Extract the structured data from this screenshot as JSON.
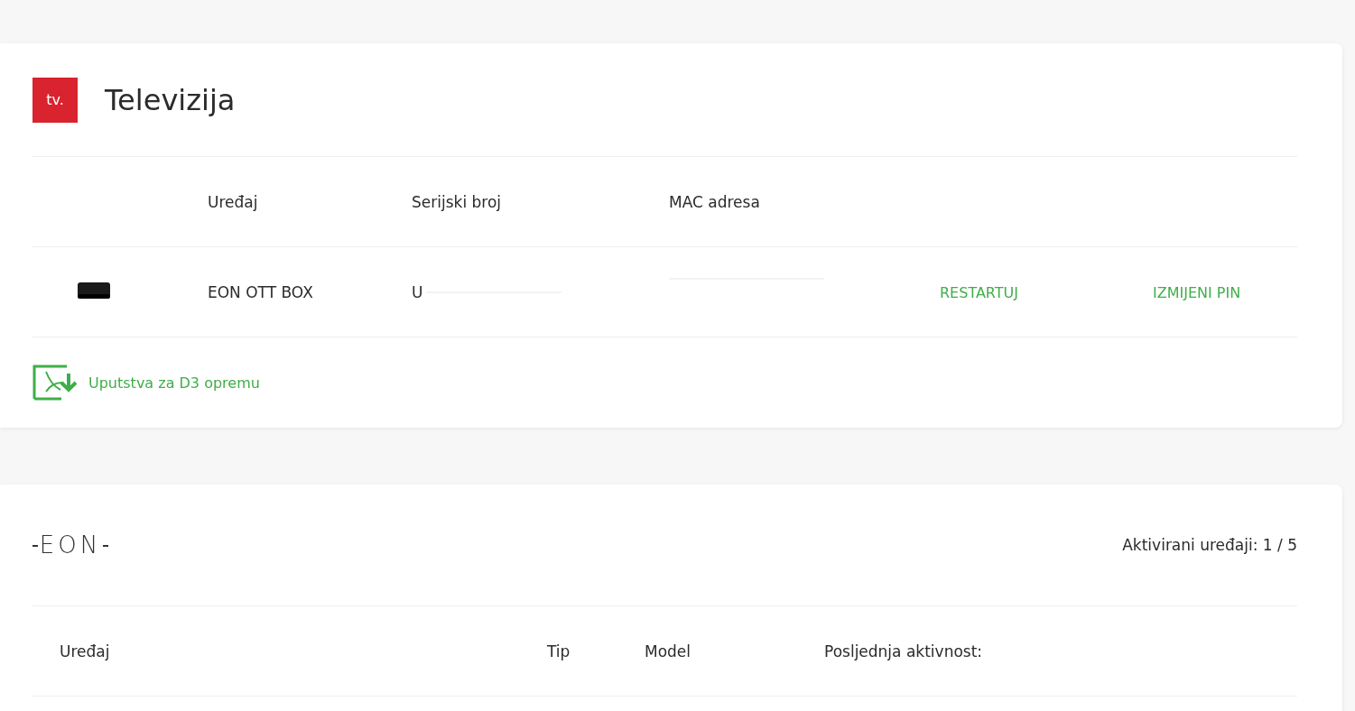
{
  "tv_card": {
    "logo": "tv.",
    "title": "Televizija",
    "columns": [
      "Uređaj",
      "Serijski broj",
      "MAC adresa"
    ],
    "devices": [
      {
        "kind": "ott_box",
        "name": "EON OTT BOX",
        "serial": "U",
        "actions": [
          "RESTARTUJ",
          "IZMIJENI PIN"
        ]
      }
    ],
    "manual_link": "Uputstva za D3 opremu"
  },
  "eon_card": {
    "logo": "EON",
    "activated": "Aktivirani uređaji: 1 / 5",
    "columns": [
      "Uređaj",
      "Tip",
      "Model",
      "Posljednja aktivnost:"
    ]
  }
}
